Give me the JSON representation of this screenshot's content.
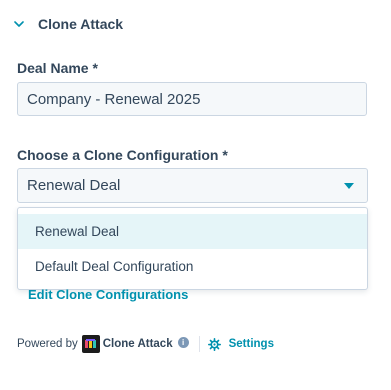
{
  "section": {
    "title": "Clone Attack"
  },
  "deal_name": {
    "label": "Deal Name *",
    "value": "Company - Renewal 2025"
  },
  "clone_config": {
    "label": "Choose a Clone Configuration *",
    "selected": "Renewal Deal",
    "options": [
      "Renewal Deal",
      "Default Deal Configuration"
    ]
  },
  "edit_link": "Edit Clone Configurations",
  "footer": {
    "powered_by": "Powered by",
    "brand": "Clone Attack",
    "info_glyph": "i",
    "settings_label": "Settings"
  },
  "icons": {
    "collapse": "chevron-down-icon",
    "select_caret": "caret-down-icon",
    "logo": "clone-attack-logo-icon",
    "info": "info-icon",
    "settings": "gear-icon"
  },
  "colors": {
    "text": "#33475b",
    "accent": "#0091ae",
    "field_background": "#f5f8fa",
    "field_border": "#cbd6e2",
    "option_highlight": "#e5f5f8"
  }
}
